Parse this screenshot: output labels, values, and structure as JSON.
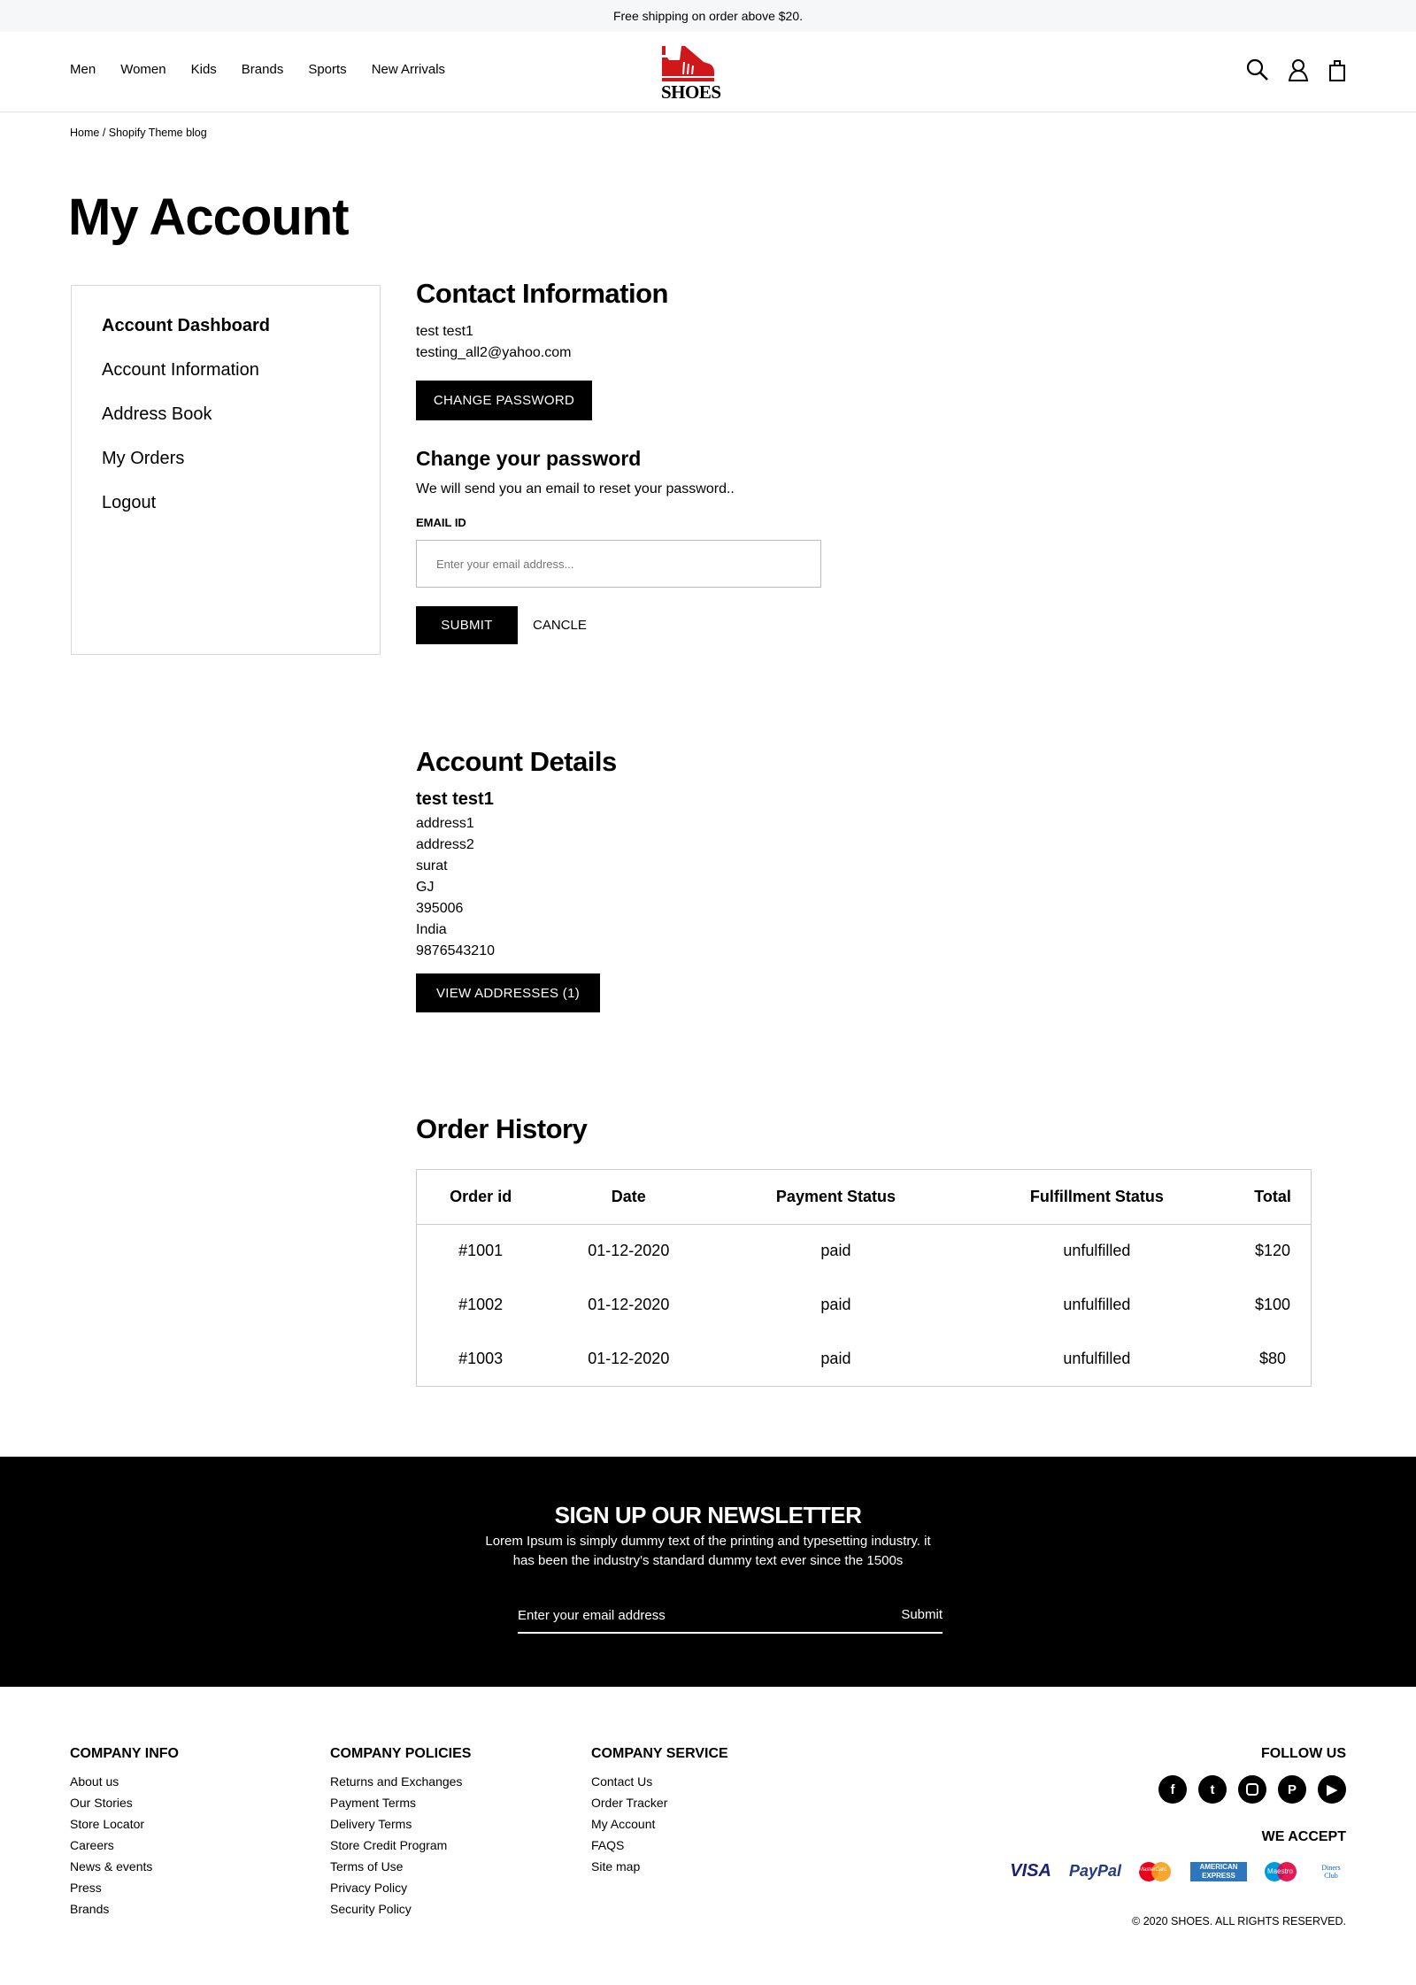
{
  "topbar": {
    "text": "Free shipping on order above $20."
  },
  "nav": [
    "Men",
    "Women",
    "Kids",
    "Brands",
    "Sports",
    "New Arrivals"
  ],
  "logo": {
    "text": "SHOES",
    "color": "#d0181a"
  },
  "breadcrumb": {
    "home": "Home",
    "current": "Shopify Theme blog"
  },
  "page_title": "My Account",
  "sidebar": [
    "Account Dashboard",
    "Account Information",
    "Address Book",
    "My Orders",
    "Logout"
  ],
  "contact": {
    "title": "Contact Information",
    "name": "test test1",
    "email": "testing_all2@yahoo.com",
    "change_password": "CHANGE PASSWORD"
  },
  "password": {
    "title": "Change your password",
    "desc": "We will send you an email to reset your password..",
    "label": "EMAIL ID",
    "placeholder": "Enter your email address...",
    "submit": "SUBMIT",
    "cancel": "CANCLE"
  },
  "account": {
    "title": "Account Details",
    "name": "test test1",
    "lines": [
      "address1",
      "address2",
      "surat",
      "GJ",
      "395006",
      "India",
      "9876543210"
    ],
    "view": "VIEW ADDRESSES (1)"
  },
  "orders": {
    "title": "Order History",
    "headers": [
      "Order id",
      "Date",
      "Payment Status",
      "Fulfillment Status",
      "Total"
    ],
    "rows": [
      [
        "#1001",
        "01-12-2020",
        "paid",
        "unfulfilled",
        "$120"
      ],
      [
        "#1002",
        "01-12-2020",
        "paid",
        "unfulfilled",
        "$100"
      ],
      [
        "#1003",
        "01-12-2020",
        "paid",
        "unfulfilled",
        "$80"
      ]
    ]
  },
  "newsletter": {
    "title": "SIGN UP OUR NEWSLETTER",
    "line1": "Lorem Ipsum is simply dummy text of the printing and typesetting industry. it",
    "line2": "has been the industry's standard dummy text ever since the 1500s",
    "placeholder": "Enter your email address",
    "submit": "Submit"
  },
  "footer": {
    "cols": [
      {
        "title": "COMPANY INFO",
        "links": [
          "About us",
          "Our Stories",
          "Store Locator",
          "Careers",
          "News & events",
          "Press",
          "Brands"
        ]
      },
      {
        "title": "COMPANY POLICIES",
        "links": [
          "Returns and Exchanges",
          "Payment Terms",
          "Delivery Terms",
          "Store Credit Program",
          "Terms of Use",
          "Privacy Policy",
          "Security Policy"
        ]
      },
      {
        "title": "COMPANY SERVICE",
        "links": [
          "Contact Us",
          "Order Tracker",
          "My Account",
          "FAQS",
          "Site map"
        ]
      }
    ],
    "follow": "FOLLOW US",
    "social": [
      "facebook-icon",
      "twitter-icon",
      "instagram-icon",
      "pinterest-icon",
      "youtube-icon"
    ],
    "accept": "WE ACCEPT",
    "payments": [
      "VISA",
      "PayPal",
      "MasterCard",
      "AMERICAN EXPRESS",
      "Maestro",
      "Diners Club"
    ],
    "copyright": "© 2020 SHOES. ALL RIGHTS RESERVED."
  }
}
